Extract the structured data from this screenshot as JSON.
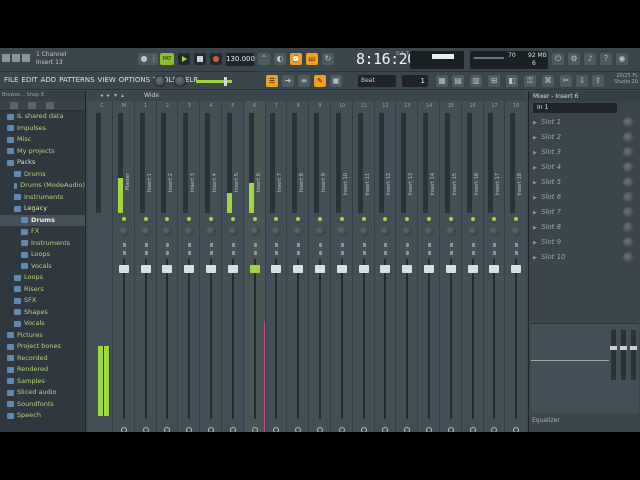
{
  "topbar": {
    "hint_line1": "1 Channel",
    "hint_line2": "Insert 13",
    "pattern_label": "PAT",
    "tempo": "130.000",
    "clock": "8:16:20",
    "bst": "B:S:T",
    "cpu_value": "70",
    "mem_value": "92 MB",
    "mem_voices": "6"
  },
  "menu": {
    "items": [
      "FILE",
      "EDIT",
      "ADD",
      "PATTERNS",
      "VIEW",
      "OPTIONS",
      "TOOLS",
      "HELP"
    ],
    "snap": "Beat",
    "step": "1",
    "version_line1": "20/25 FL",
    "version_line2": "Studio 20"
  },
  "browser": {
    "header": "Browse... Snap 8",
    "items": [
      {
        "label": "IL shared data",
        "indent": 1,
        "state": ""
      },
      {
        "label": "Impulses",
        "indent": 1,
        "state": ""
      },
      {
        "label": "Misc",
        "indent": 1,
        "state": ""
      },
      {
        "label": "My projects",
        "indent": 1,
        "state": ""
      },
      {
        "label": "Packs",
        "indent": 1,
        "state": "open"
      },
      {
        "label": "Drums",
        "indent": 2,
        "state": ""
      },
      {
        "label": "Drums (ModeAudio)",
        "indent": 2,
        "state": ""
      },
      {
        "label": "Instruments",
        "indent": 2,
        "state": ""
      },
      {
        "label": "Legacy",
        "indent": 2,
        "state": "open"
      },
      {
        "label": "Drums",
        "indent": 3,
        "state": "sel"
      },
      {
        "label": "FX",
        "indent": 3,
        "state": ""
      },
      {
        "label": "Instruments",
        "indent": 3,
        "state": ""
      },
      {
        "label": "Loops",
        "indent": 3,
        "state": ""
      },
      {
        "label": "Vocals",
        "indent": 3,
        "state": ""
      },
      {
        "label": "Loops",
        "indent": 2,
        "state": ""
      },
      {
        "label": "Risers",
        "indent": 2,
        "state": ""
      },
      {
        "label": "SFX",
        "indent": 2,
        "state": ""
      },
      {
        "label": "Shapes",
        "indent": 2,
        "state": ""
      },
      {
        "label": "Vocals",
        "indent": 2,
        "state": ""
      },
      {
        "label": "Pictures",
        "indent": 1,
        "state": ""
      },
      {
        "label": "Project bones",
        "indent": 1,
        "state": ""
      },
      {
        "label": "Recorded",
        "indent": 1,
        "state": ""
      },
      {
        "label": "Rendered",
        "indent": 1,
        "state": ""
      },
      {
        "label": "Samples",
        "indent": 1,
        "state": ""
      },
      {
        "label": "Sliced audio",
        "indent": 1,
        "state": ""
      },
      {
        "label": "Soundfonts",
        "indent": 1,
        "state": ""
      },
      {
        "label": "Speech",
        "indent": 1,
        "state": ""
      }
    ]
  },
  "mixer": {
    "view_label": "Wide",
    "selected_strip": 6,
    "strips": [
      {
        "num": "C",
        "name": "",
        "level": 0.0
      },
      {
        "num": "M",
        "name": "Master",
        "level": 0.35
      },
      {
        "num": "1",
        "name": "Insert 1",
        "level": 0.0
      },
      {
        "num": "2",
        "name": "Insert 2",
        "level": 0.0
      },
      {
        "num": "3",
        "name": "Insert 3",
        "level": 0.0
      },
      {
        "num": "4",
        "name": "Insert 4",
        "level": 0.0
      },
      {
        "num": "5",
        "name": "Insert 5",
        "level": 0.2
      },
      {
        "num": "6",
        "name": "Insert 6",
        "level": 0.3
      },
      {
        "num": "7",
        "name": "Insert 7",
        "level": 0.0
      },
      {
        "num": "8",
        "name": "Insert 8",
        "level": 0.0
      },
      {
        "num": "9",
        "name": "Insert 9",
        "level": 0.0
      },
      {
        "num": "10",
        "name": "Insert 10",
        "level": 0.0
      },
      {
        "num": "11",
        "name": "Insert 11",
        "level": 0.0
      },
      {
        "num": "12",
        "name": "Insert 12",
        "level": 0.0
      },
      {
        "num": "13",
        "name": "Insert 13",
        "level": 0.0
      },
      {
        "num": "14",
        "name": "Insert 14",
        "level": 0.0
      },
      {
        "num": "15",
        "name": "Insert 15",
        "level": 0.0
      },
      {
        "num": "16",
        "name": "Insert 16",
        "level": 0.0
      },
      {
        "num": "17",
        "name": "Insert 17",
        "level": 0.0
      },
      {
        "num": "18",
        "name": "Insert 18",
        "level": 0.0
      }
    ]
  },
  "insert_panel": {
    "title": "Mixer - Insert 6",
    "input": "In 1",
    "slots": [
      "Slot 1",
      "Slot 2",
      "Slot 3",
      "Slot 4",
      "Slot 5",
      "Slot 6",
      "Slot 7",
      "Slot 8",
      "Slot 9",
      "Slot 10"
    ],
    "eq_label": "Equalizer"
  }
}
